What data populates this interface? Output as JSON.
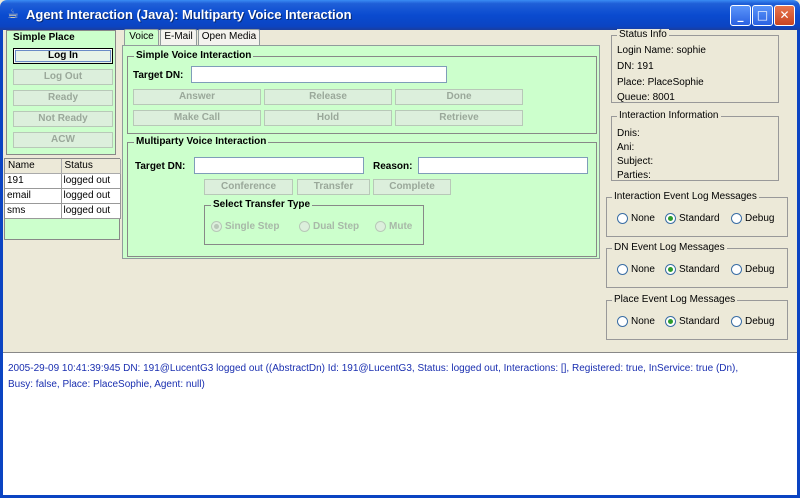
{
  "window": {
    "title": "Agent Interaction (Java): Multiparty Voice Interaction",
    "icon": "java-cup-icon",
    "minimize_glyph": "_",
    "maximize_glyph": "□",
    "close_glyph": "✕"
  },
  "simple_place": {
    "title": "Simple Place",
    "buttons": [
      {
        "label": "Log In",
        "enabled": true
      },
      {
        "label": "Log Out",
        "enabled": false
      },
      {
        "label": "Ready",
        "enabled": false
      },
      {
        "label": "Not Ready",
        "enabled": false
      },
      {
        "label": "ACW",
        "enabled": false
      }
    ]
  },
  "media_table": {
    "headers": [
      "Name",
      "Status"
    ],
    "rows": [
      [
        "191",
        "logged out"
      ],
      [
        "email",
        "logged out"
      ],
      [
        "sms",
        "logged out"
      ]
    ]
  },
  "tabs": [
    {
      "label": "Voice",
      "active": true
    },
    {
      "label": "E-Mail",
      "active": false
    },
    {
      "label": "Open Media",
      "active": false
    }
  ],
  "simple_voice": {
    "title": "Simple Voice Interaction",
    "target_dn_label": "Target DN:",
    "target_dn_value": "",
    "buttons": [
      "Answer",
      "Release",
      "Done",
      "Make Call",
      "Hold",
      "Retrieve"
    ]
  },
  "multiparty": {
    "title": "Multiparty Voice Interaction",
    "target_dn_label": "Target DN:",
    "target_dn_value": "",
    "reason_label": "Reason:",
    "reason_value": "",
    "buttons": [
      "Conference",
      "Transfer",
      "Complete"
    ],
    "transfer_type": {
      "title": "Select Transfer Type",
      "options": [
        "Single Step",
        "Dual Step",
        "Mute"
      ],
      "selected": "Single Step"
    }
  },
  "status_info": {
    "title": "Status Info",
    "login_name": "Login Name: sophie",
    "dn": "DN: 191",
    "place": "Place: PlaceSophie",
    "queue": "Queue: 8001"
  },
  "interaction_info": {
    "title": "Interaction Information",
    "dnis": "Dnis:",
    "ani": "Ani:",
    "subject": "Subject:",
    "parties": "Parties:"
  },
  "log_panels": [
    {
      "title": "Interaction Event Log Messages",
      "options": [
        "None",
        "Standard",
        "Debug"
      ],
      "selected": "Standard"
    },
    {
      "title": "DN Event Log Messages",
      "options": [
        "None",
        "Standard",
        "Debug"
      ],
      "selected": "Standard"
    },
    {
      "title": "Place Event Log Messages",
      "options": [
        "None",
        "Standard",
        "Debug"
      ],
      "selected": "Standard"
    }
  ],
  "log": {
    "line1": "2005-29-09 10:41:39:945 DN: 191@LucentG3   logged out ((AbstractDn) Id: 191@LucentG3, Status: logged out, Interactions: [], Registered: true, InService: true (Dn),",
    "line2": "Busy: false, Place: PlaceSophie, Agent: null)"
  }
}
